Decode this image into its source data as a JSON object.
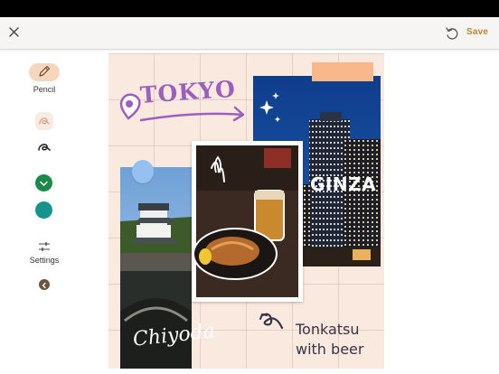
{
  "topbar": {
    "close_icon": "close-icon",
    "undo_icon": "undo-icon",
    "save_label": "Save",
    "save_color": "#b8862f"
  },
  "toolbar": {
    "pencil_label": "Pencil",
    "pencil_icon": "pencil-icon",
    "settings_label": "Settings",
    "settings_icon": "sliders-icon",
    "back_icon": "back-arrow-icon",
    "colors": [
      "#1c8a47",
      "#16938c"
    ]
  },
  "collage": {
    "tokyo_label": "TOKYO",
    "ginza_label": "GINZA",
    "chiyoda_label": "Chiyoda",
    "caption_line1": "Tonkatsu",
    "caption_line2": "with beer",
    "accent_purple": "#9b5fc0",
    "tape_color": "#f8b88c",
    "pin_color": "#94c1f2"
  }
}
